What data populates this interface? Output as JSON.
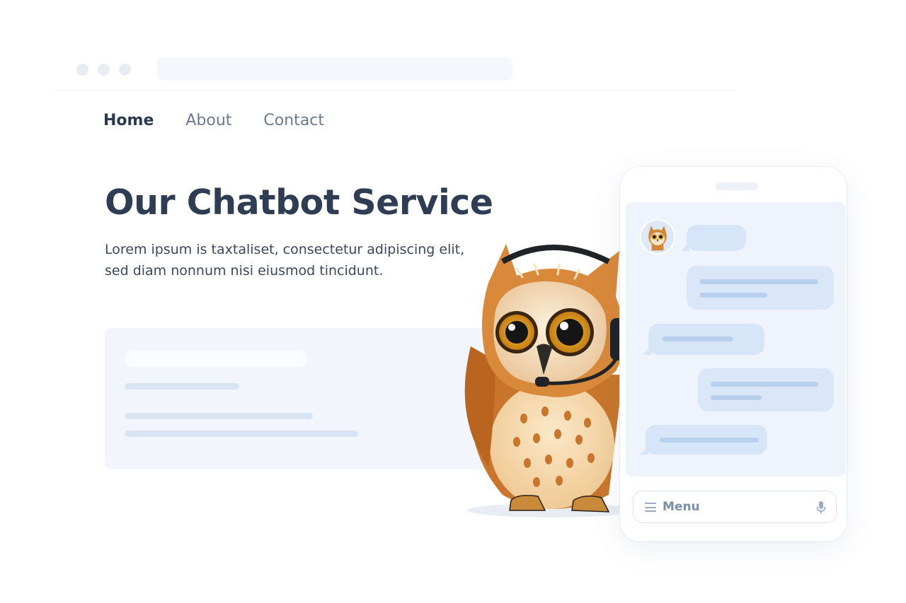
{
  "nav": {
    "items": [
      {
        "label": "Home",
        "active": true
      },
      {
        "label": "About",
        "active": false
      },
      {
        "label": "Contact",
        "active": false
      }
    ]
  },
  "hero": {
    "title": "Our Chatbot Service",
    "text_line1": "Lorem ipsum is taxtaliset, consectetur adipiscing elit,",
    "text_line2": "sed diam nonnum nisi eiusmod tincidunt."
  },
  "chat": {
    "input_label": "Menu",
    "menu_icon": "hamburger-icon",
    "mic_icon": "microphone-icon",
    "avatar": "owl-avatar"
  },
  "colors": {
    "heading": "#2f3d54",
    "nav_active": "#2b3950",
    "nav_inactive": "#6b7a90",
    "bubble": "#d6e6f8",
    "chat_bg": "#eff4fc",
    "owl_body": "#c9762c"
  }
}
